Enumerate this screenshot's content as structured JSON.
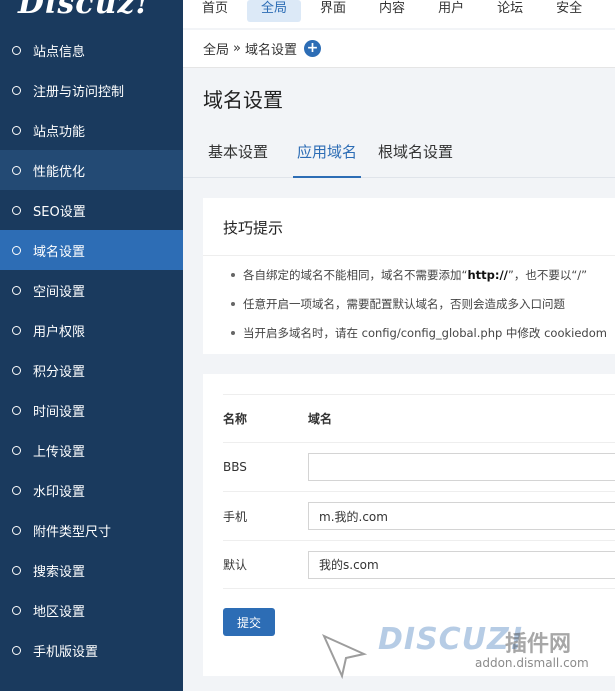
{
  "logo": {
    "text": "Discuz!"
  },
  "topnav": [
    {
      "label": "首页",
      "active": false
    },
    {
      "label": "全局",
      "active": true
    },
    {
      "label": "界面",
      "active": false
    },
    {
      "label": "内容",
      "active": false
    },
    {
      "label": "用户",
      "active": false
    },
    {
      "label": "论坛",
      "active": false
    },
    {
      "label": "安全",
      "active": false
    }
  ],
  "sidebar": {
    "items": [
      {
        "label": "站点信息"
      },
      {
        "label": "注册与访问控制"
      },
      {
        "label": "站点功能"
      },
      {
        "label": "性能优化"
      },
      {
        "label": "SEO设置"
      },
      {
        "label": "域名设置"
      },
      {
        "label": "空间设置"
      },
      {
        "label": "用户权限"
      },
      {
        "label": "积分设置"
      },
      {
        "label": "时间设置"
      },
      {
        "label": "上传设置"
      },
      {
        "label": "水印设置"
      },
      {
        "label": "附件类型尺寸"
      },
      {
        "label": "搜索设置"
      },
      {
        "label": "地区设置"
      },
      {
        "label": "手机版设置"
      }
    ]
  },
  "breadcrumb": {
    "root": "全局",
    "sep": "»",
    "current": "域名设置",
    "plus": "+"
  },
  "page": {
    "title": "域名设置"
  },
  "tabs": [
    {
      "label": "基本设置"
    },
    {
      "label": "应用域名"
    },
    {
      "label": "根域名设置"
    }
  ],
  "tips": {
    "title": "技巧提示",
    "items": [
      {
        "pre": "各自绑定的域名不能相同，域名不需要添加“",
        "bold": "http://",
        "post": "”，也不要以“/”"
      },
      {
        "pre": "任意开启一项域名，需要配置默认域名，否则会造成多入口问题",
        "bold": "",
        "post": ""
      },
      {
        "pre": "当开启多域名时，请在 config/config_global.php 中修改 cookiedom",
        "bold": "",
        "post": ""
      }
    ]
  },
  "form": {
    "col_name": "名称",
    "col_domain": "域名",
    "rows": [
      {
        "label": "BBS",
        "value": ""
      },
      {
        "label": "手机",
        "value": "m.我的.com"
      },
      {
        "label": "默认",
        "value": "我的s.com"
      }
    ],
    "submit": "提交"
  },
  "watermark": {
    "big": "DISCUZ!",
    "cn": "插件网",
    "url": "addon.dismall.com"
  }
}
